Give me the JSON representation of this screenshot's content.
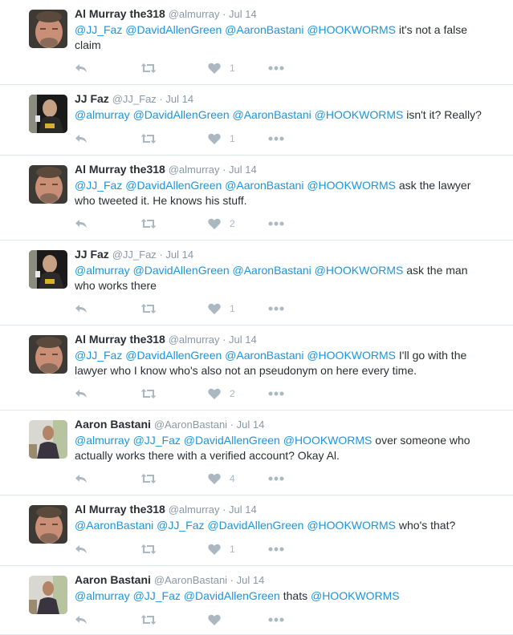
{
  "tweets": [
    {
      "avatar": "al-murray",
      "name": "Al Murray the318",
      "handle": "@almurray",
      "time": "Jul 14",
      "body": [
        {
          "t": "mention",
          "s": "@JJ_Faz"
        },
        {
          "t": "text",
          "s": " "
        },
        {
          "t": "mention",
          "s": "@DavidAllenGreen"
        },
        {
          "t": "text",
          "s": " "
        },
        {
          "t": "mention",
          "s": "@AaronBastani"
        },
        {
          "t": "text",
          "s": " "
        },
        {
          "t": "mention",
          "s": "@HOOKWORMS"
        },
        {
          "t": "text",
          "s": " it's not a false claim"
        }
      ],
      "likes": "1"
    },
    {
      "avatar": "jj-faz",
      "name": "JJ Faz",
      "handle": "@JJ_Faz",
      "time": "Jul 14",
      "body": [
        {
          "t": "mention",
          "s": "@almurray"
        },
        {
          "t": "text",
          "s": " "
        },
        {
          "t": "mention",
          "s": "@DavidAllenGreen"
        },
        {
          "t": "text",
          "s": " "
        },
        {
          "t": "mention",
          "s": "@AaronBastani"
        },
        {
          "t": "text",
          "s": " "
        },
        {
          "t": "mention",
          "s": "@HOOKWORMS"
        },
        {
          "t": "text",
          "s": " isn't it? Really?"
        }
      ],
      "likes": "1"
    },
    {
      "avatar": "al-murray",
      "name": "Al Murray the318",
      "handle": "@almurray",
      "time": "Jul 14",
      "body": [
        {
          "t": "mention",
          "s": "@JJ_Faz"
        },
        {
          "t": "text",
          "s": " "
        },
        {
          "t": "mention",
          "s": "@DavidAllenGreen"
        },
        {
          "t": "text",
          "s": " "
        },
        {
          "t": "mention",
          "s": "@AaronBastani"
        },
        {
          "t": "text",
          "s": " "
        },
        {
          "t": "mention",
          "s": "@HOOKWORMS"
        },
        {
          "t": "text",
          "s": " ask the lawyer who tweeted it. He knows his stuff."
        }
      ],
      "likes": "2"
    },
    {
      "avatar": "jj-faz",
      "name": "JJ Faz",
      "handle": "@JJ_Faz",
      "time": "Jul 14",
      "body": [
        {
          "t": "mention",
          "s": "@almurray"
        },
        {
          "t": "text",
          "s": " "
        },
        {
          "t": "mention",
          "s": "@DavidAllenGreen"
        },
        {
          "t": "text",
          "s": " "
        },
        {
          "t": "mention",
          "s": "@AaronBastani"
        },
        {
          "t": "text",
          "s": " "
        },
        {
          "t": "mention",
          "s": "@HOOKWORMS"
        },
        {
          "t": "text",
          "s": " ask the man who works there"
        }
      ],
      "likes": "1"
    },
    {
      "avatar": "al-murray",
      "name": "Al Murray the318",
      "handle": "@almurray",
      "time": "Jul 14",
      "body": [
        {
          "t": "mention",
          "s": "@JJ_Faz"
        },
        {
          "t": "text",
          "s": " "
        },
        {
          "t": "mention",
          "s": "@DavidAllenGreen"
        },
        {
          "t": "text",
          "s": " "
        },
        {
          "t": "mention",
          "s": "@AaronBastani"
        },
        {
          "t": "text",
          "s": " "
        },
        {
          "t": "mention",
          "s": "@HOOKWORMS"
        },
        {
          "t": "text",
          "s": " I'll go with the lawyer who I know who's also not an pseudonym on here every time."
        }
      ],
      "likes": "2"
    },
    {
      "avatar": "aaron-bastani",
      "name": "Aaron Bastani",
      "handle": "@AaronBastani",
      "time": "Jul 14",
      "body": [
        {
          "t": "mention",
          "s": "@almurray"
        },
        {
          "t": "text",
          "s": " "
        },
        {
          "t": "mention",
          "s": "@JJ_Faz"
        },
        {
          "t": "text",
          "s": " "
        },
        {
          "t": "mention",
          "s": "@DavidAllenGreen"
        },
        {
          "t": "text",
          "s": " "
        },
        {
          "t": "mention",
          "s": "@HOOKWORMS"
        },
        {
          "t": "text",
          "s": " over someone who actually works there with a verified account? Okay Al."
        }
      ],
      "likes": "4"
    },
    {
      "avatar": "al-murray",
      "name": "Al Murray the318",
      "handle": "@almurray",
      "time": "Jul 14",
      "body": [
        {
          "t": "mention",
          "s": "@AaronBastani"
        },
        {
          "t": "text",
          "s": " "
        },
        {
          "t": "mention",
          "s": "@JJ_Faz"
        },
        {
          "t": "text",
          "s": " "
        },
        {
          "t": "mention",
          "s": "@DavidAllenGreen"
        },
        {
          "t": "text",
          "s": " "
        },
        {
          "t": "mention",
          "s": "@HOOKWORMS"
        },
        {
          "t": "text",
          "s": " who's that?"
        }
      ],
      "likes": "1"
    },
    {
      "avatar": "aaron-bastani",
      "name": "Aaron Bastani",
      "handle": "@AaronBastani",
      "time": "Jul 14",
      "body": [
        {
          "t": "mention",
          "s": "@almurray"
        },
        {
          "t": "text",
          "s": " "
        },
        {
          "t": "mention",
          "s": "@JJ_Faz"
        },
        {
          "t": "text",
          "s": " "
        },
        {
          "t": "mention",
          "s": "@DavidAllenGreen"
        },
        {
          "t": "text",
          "s": " thats "
        },
        {
          "t": "mention",
          "s": "@HOOKWORMS"
        }
      ],
      "likes": ""
    }
  ],
  "colors": {
    "mention": "#1b95e0",
    "muted": "#8899a6",
    "icon": "#aab8c2",
    "divider": "#e1e8ed"
  },
  "icons": {
    "reply": "reply-icon",
    "retweet": "retweet-icon",
    "like": "heart-icon",
    "more": "more-icon"
  }
}
